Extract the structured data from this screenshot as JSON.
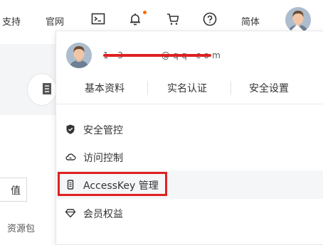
{
  "topbar": {
    "support": "支持",
    "website": "官网",
    "language": "简体",
    "icons": [
      "terminal-icon",
      "bell-icon",
      "cart-icon",
      "help-icon"
    ]
  },
  "background": {
    "button_fragment": "值",
    "text_fragment": "资源包"
  },
  "dropdown": {
    "account_masked": "1 · 3 ·  ·  · · · · @ q q · c o m",
    "tabs": [
      "基本资料",
      "实名认证",
      "安全设置"
    ],
    "menu": [
      {
        "label": "安全管控",
        "icon": "shield-icon"
      },
      {
        "label": "访问控制",
        "icon": "cloud-icon"
      },
      {
        "label": "AccessKey 管理",
        "icon": "key-icon"
      },
      {
        "label": "会员权益",
        "icon": "diamond-icon"
      }
    ]
  },
  "colors": {
    "highlight_box": "#e02020",
    "notify_dot": "#ff6a00"
  }
}
